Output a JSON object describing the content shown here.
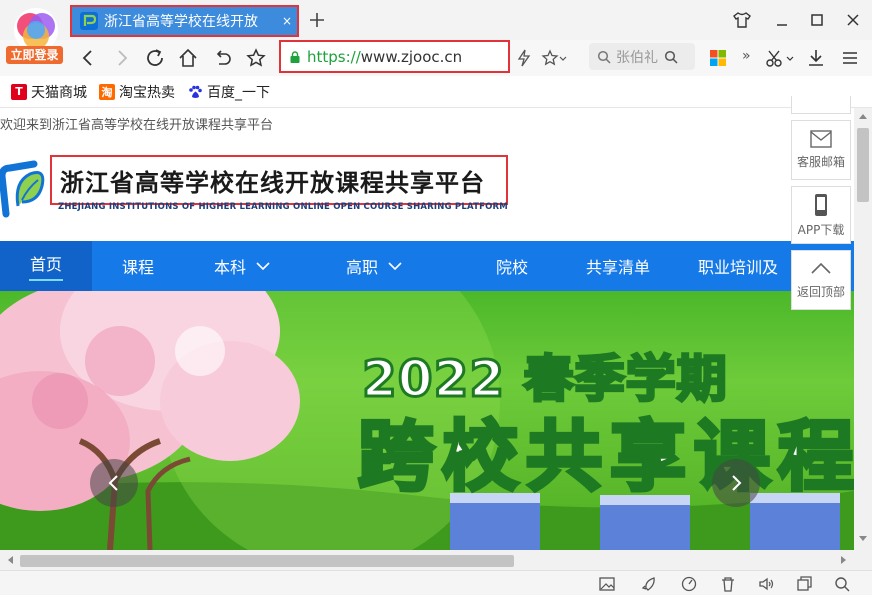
{
  "browser": {
    "login_label": "立即登录",
    "tab_title": "浙江省高等学校在线开放",
    "tab_close": "×",
    "url_scheme": "https://",
    "url_host": "www.zjooc.cn",
    "search_placeholder": "张伯礼",
    "more_label": "»"
  },
  "bookmarks": [
    {
      "label": "天猫商城",
      "icon": "tmall-icon",
      "color": "#e0001b",
      "glyph": "T"
    },
    {
      "label": "淘宝热卖",
      "icon": "taobao-icon",
      "color": "#ff6a00",
      "glyph": "淘"
    },
    {
      "label": "百度_一下",
      "icon": "baidu-paw-icon",
      "color": "#2932e1",
      "glyph": ""
    }
  ],
  "page": {
    "welcome": "欢迎来到浙江省高等学校在线开放课程共享平台",
    "site_title": "浙江省高等学校在线开放课程共享平台",
    "site_subtitle": "ZHEJIANG INSTITUTIONS OF HIGHER LEARNING ONLINE OPEN COURSE SHARING PLATFORM",
    "menu": [
      {
        "label": "首页",
        "active": true
      },
      {
        "label": "课程",
        "active": false
      },
      {
        "label": "本科",
        "active": false,
        "dropdown": true
      },
      {
        "label": "高职",
        "active": false,
        "dropdown": true
      },
      {
        "label": "院校",
        "active": false
      },
      {
        "label": "共享清单",
        "active": false
      },
      {
        "label": "职业培训及",
        "active": false
      }
    ],
    "banner_year": "2022 春季学期",
    "banner_main": "跨校共享课程",
    "colors": {
      "menu": "#1679e8",
      "accent_red": "#e0343a",
      "banner_green": "#4bb82a"
    }
  },
  "side": {
    "email_label": "客服邮箱",
    "app_label": "APP下载",
    "top_label": "返回顶部"
  }
}
